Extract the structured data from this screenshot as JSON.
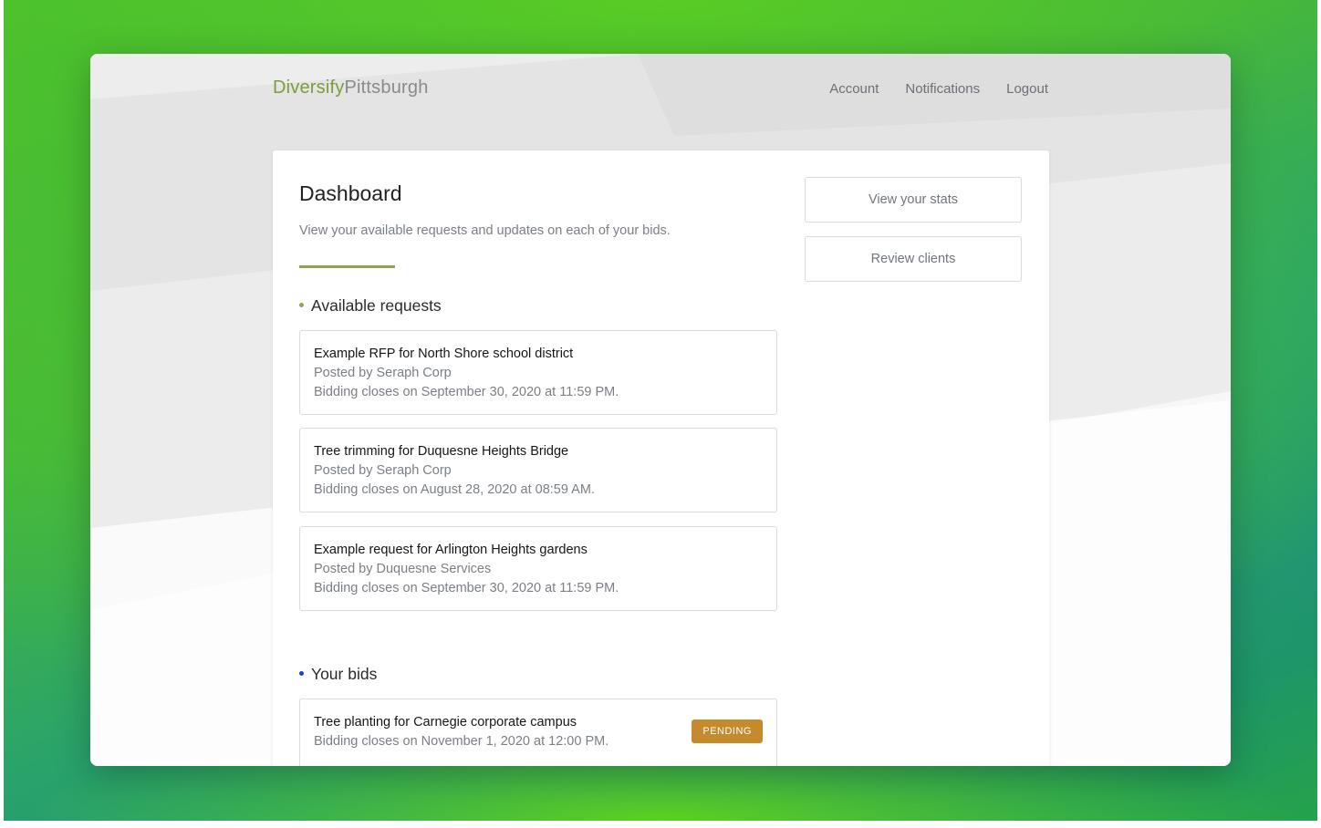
{
  "brand": {
    "part1": "Diversify",
    "part2": "Pittsburgh"
  },
  "nav": {
    "account": "Account",
    "notifications": "Notifications",
    "logout": "Logout"
  },
  "dashboard": {
    "title": "Dashboard",
    "subtitle": "View your available requests and updates on each of your bids."
  },
  "side_buttons": {
    "stats": "View your stats",
    "clients": "Review clients"
  },
  "available": {
    "heading": "Available requests",
    "items": [
      {
        "title": "Example RFP for North Shore school district",
        "posted": "Posted by Seraph Corp",
        "closes": "Bidding closes on September 30, 2020 at 11:59 PM."
      },
      {
        "title": "Tree trimming for Duquesne Heights Bridge",
        "posted": "Posted by Seraph Corp",
        "closes": "Bidding closes on August 28, 2020 at 08:59 AM."
      },
      {
        "title": "Example request for Arlington Heights gardens",
        "posted": "Posted by Duquesne Services",
        "closes": "Bidding closes on September 30, 2020 at 11:59 PM."
      }
    ]
  },
  "bids": {
    "heading": "Your bids",
    "items": [
      {
        "title": "Tree planting for Carnegie corporate campus",
        "closes": "Bidding closes on November 1, 2020 at 12:00 PM.",
        "status": "PENDING"
      }
    ]
  },
  "colors": {
    "brand_green": "#7a9e3b",
    "divider_green": "#8aa652",
    "available_dot": "#8aa652",
    "bids_dot": "#1a3fd6",
    "pending_badge": "#c48a2b"
  }
}
